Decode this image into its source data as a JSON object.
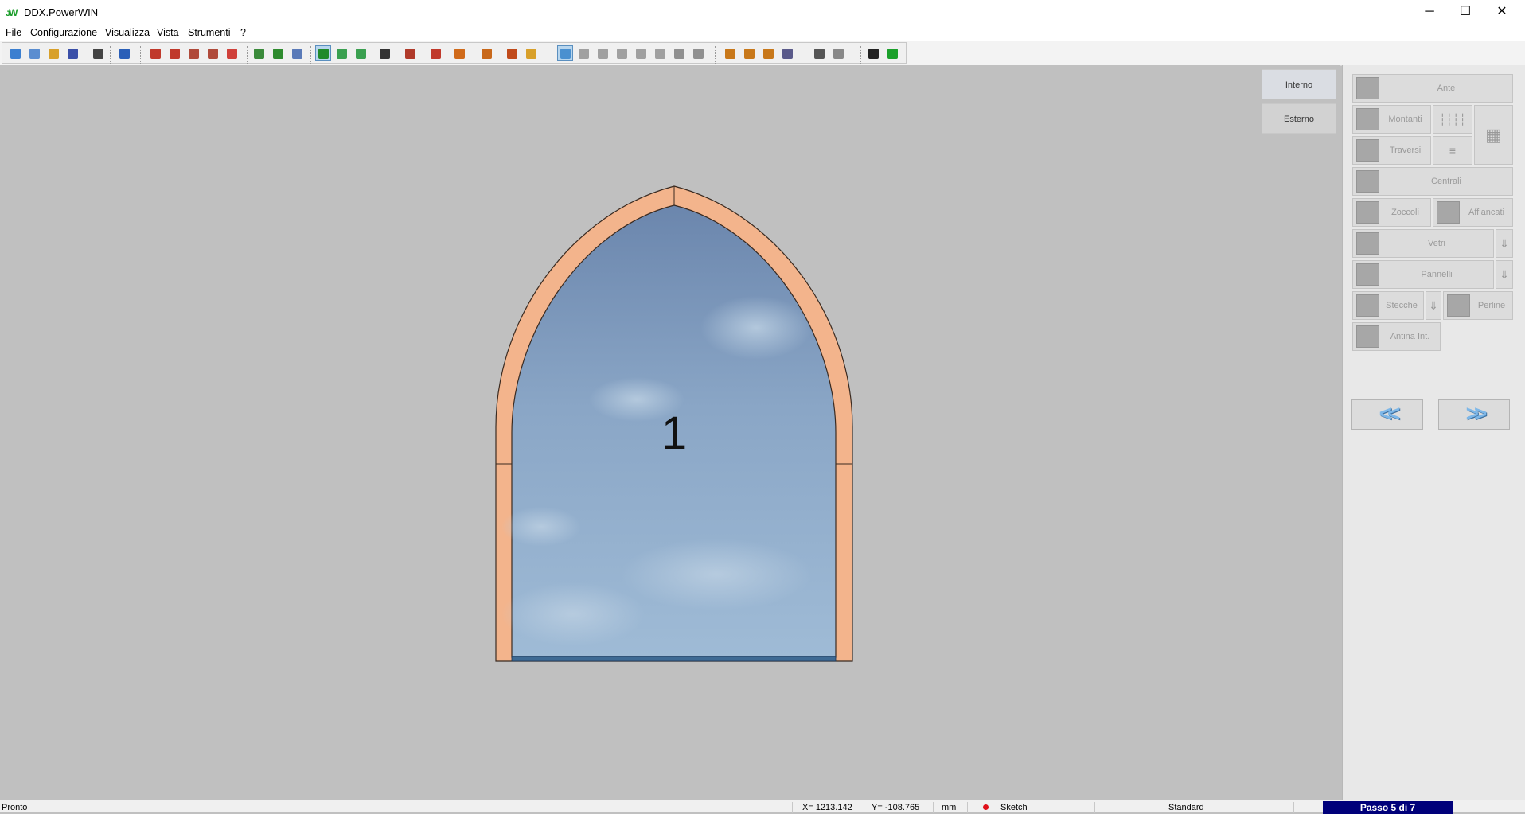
{
  "window": {
    "title": "DDX.PowerWIN",
    "minimize": "─",
    "maximize": "☐",
    "close": "✕"
  },
  "menu": [
    "File",
    "Configurazione",
    "Visualizza",
    "Vista",
    "Strumenti",
    "?"
  ],
  "toolbar": {
    "icons": [
      {
        "name": "new-icon",
        "color": "#3b7fd0"
      },
      {
        "name": "open-icon",
        "color": "#5a8dd0"
      },
      {
        "name": "globe-icon",
        "color": "#d8a02a"
      },
      {
        "name": "save-icon",
        "color": "#3a4fa8"
      },
      {
        "name": "mail-icon",
        "color": "#444444"
      },
      {
        "name": "info-icon",
        "color": "#2a5fb8"
      },
      {
        "name": "zoom-icon",
        "color": "#c0392b"
      },
      {
        "name": "zoom-window-icon",
        "color": "#c0392b"
      },
      {
        "name": "zoom-out-icon",
        "color": "#b04a3a"
      },
      {
        "name": "zoom-in-icon",
        "color": "#b04a3a"
      },
      {
        "name": "pan-hand-icon",
        "color": "#d0403a"
      },
      {
        "name": "select-icon",
        "color": "#3a8a3a"
      },
      {
        "name": "measure-icon",
        "color": "#2e8b2e"
      },
      {
        "name": "report-icon",
        "color": "#5a7ab8"
      },
      {
        "name": "view-3d-solid-icon",
        "color": "#1f8a2a"
      },
      {
        "name": "view-3d-wire-icon",
        "color": "#3aa050"
      },
      {
        "name": "view-3d-front-icon",
        "color": "#3aa050"
      },
      {
        "name": "bomb-icon",
        "color": "#333333"
      },
      {
        "name": "cut-list-icon",
        "color": "#b03a2a"
      },
      {
        "name": "grid-icon",
        "color": "#c0392b"
      },
      {
        "name": "chart-icon",
        "color": "#d06a1a"
      },
      {
        "name": "door-icon",
        "color": "#c8681a"
      },
      {
        "name": "image-icon",
        "color": "#c04a1a"
      },
      {
        "name": "folder-image-icon",
        "color": "#d8a02a"
      },
      {
        "name": "cube-blue-icon",
        "color": "#4a90d0"
      },
      {
        "name": "cube-top-icon",
        "color": "#a0a0a0"
      },
      {
        "name": "cube-left-icon",
        "color": "#a0a0a0"
      },
      {
        "name": "cube-right-icon",
        "color": "#a0a0a0"
      },
      {
        "name": "cube-back-icon",
        "color": "#a0a0a0"
      },
      {
        "name": "cube-bottom-icon",
        "color": "#a0a0a0"
      },
      {
        "name": "cube-iso-icon",
        "color": "#909090"
      },
      {
        "name": "square-icon",
        "color": "#909090"
      },
      {
        "name": "profile-corner-icon",
        "color": "#c8781a"
      },
      {
        "name": "profile-l-icon",
        "color": "#c8781a"
      },
      {
        "name": "profile-frame-icon",
        "color": "#c8781a"
      },
      {
        "name": "profile-double-icon",
        "color": "#5a5a8a"
      },
      {
        "name": "undo-arc-icon",
        "color": "#555555"
      },
      {
        "name": "redo-arc-icon",
        "color": "#888888"
      },
      {
        "name": "user-icon",
        "color": "#222222"
      },
      {
        "name": "envelope-green-icon",
        "color": "#1aa02a"
      }
    ]
  },
  "view_toggle": {
    "interno": "Interno",
    "esterno": "Esterno"
  },
  "window_drawing": {
    "sash_number": "1",
    "frame_color": "#f2b58f",
    "glass_color": "#7fa4cc"
  },
  "right_panel": {
    "ante": "Ante",
    "montanti": "Montanti",
    "traversi": "Traversi",
    "centrali": "Centrali",
    "zoccoli": "Zoccoli",
    "affiancati": "Affiancati",
    "vetri": "Vetri",
    "pannelli": "Pannelli",
    "stecche": "Stecche",
    "perline": "Perline",
    "antina_int": "Antina Int.",
    "back": "<<",
    "forward": ">>"
  },
  "status": {
    "ready": "Pronto",
    "x": "X= 1213.142",
    "y": "Y= -108.765",
    "unit": "mm",
    "mode": "Sketch",
    "style": "Standard",
    "step": "Passo 5 di 7"
  }
}
